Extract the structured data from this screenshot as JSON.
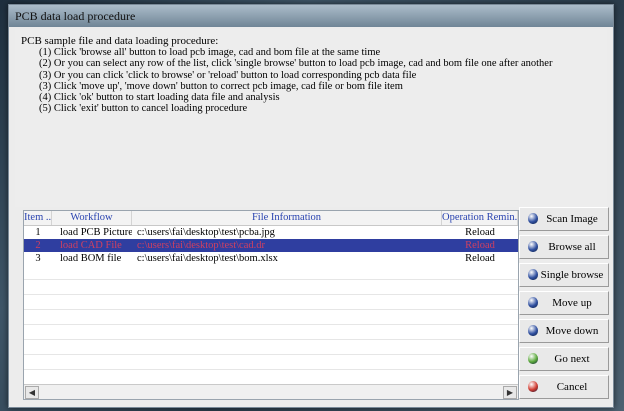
{
  "window": {
    "title": "PCB data load procedure"
  },
  "instructions": {
    "heading": "PCB sample file and data loading procedure:",
    "steps": [
      "(1) Click 'browse all' button to load pcb image, cad and bom file at the same time",
      "(2) Or you can select any row of the list, click 'single browse' button to load pcb image, cad and bom file one after another",
      "(3) Or you can click 'click to browse' or 'reload' button to load corresponding pcb data file",
      "(3) Click 'move up', 'move down' button to correct pcb image, cad file or bom file item",
      "(4) Click 'ok' button to start loading data file and analysis",
      "(5) Click 'exit' button to cancel loading procedure"
    ]
  },
  "table": {
    "columns": [
      "Item ...",
      "Workflow",
      "File Information",
      "Operation Remin..."
    ],
    "rows": [
      {
        "item": "1",
        "workflow": "load PCB Picture",
        "file": "c:\\users\\fai\\desktop\\test\\pcba.jpg",
        "op": "Reload",
        "selected": false
      },
      {
        "item": "2",
        "workflow": "load CAD File",
        "file": "c:\\users\\fai\\desktop\\test\\cad.dr",
        "op": "Reload",
        "selected": true
      },
      {
        "item": "3",
        "workflow": "load BOM file",
        "file": "c:\\users\\fai\\desktop\\test\\bom.xlsx",
        "op": "Reload",
        "selected": false
      }
    ]
  },
  "buttons": [
    {
      "name": "scan-image-button",
      "label": "Scan Image",
      "icon": "blue-sphere-icon",
      "color": "#2f4fa0"
    },
    {
      "name": "browse-all-button",
      "label": "Browse all",
      "icon": "blue-sphere-icon",
      "color": "#2f4fa0"
    },
    {
      "name": "single-browse-button",
      "label": "Single browse",
      "icon": "blue-sphere-icon",
      "color": "#2f4fa0"
    },
    {
      "name": "move-up-button",
      "label": "Move up",
      "icon": "blue-sphere-icon",
      "color": "#2f4fa0"
    },
    {
      "name": "move-down-button",
      "label": "Move down",
      "icon": "blue-sphere-icon",
      "color": "#2f4fa0"
    },
    {
      "name": "go-next-button",
      "label": "Go next",
      "icon": "green-sphere-icon",
      "color": "#5aa83a"
    },
    {
      "name": "cancel-button",
      "label": "Cancel",
      "icon": "red-sphere-icon",
      "color": "#d03a2f"
    }
  ],
  "scrollbar": {
    "left_arrow": "◀",
    "right_arrow": "▶"
  }
}
